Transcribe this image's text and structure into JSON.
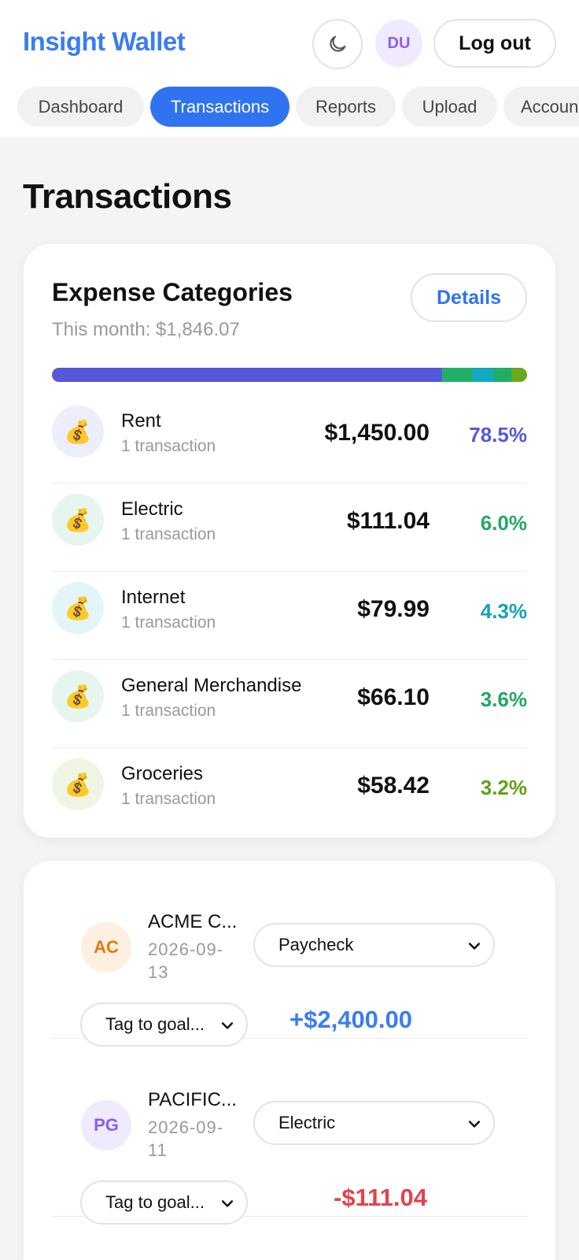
{
  "header": {
    "brand": "Insight Wallet",
    "theme_icon": "moon-icon",
    "user_initials": "DU",
    "logout_label": "Log out",
    "colors": {
      "brand": "#3b7cf0",
      "active_tab": "#2f73f0"
    }
  },
  "tabs": [
    {
      "label": "Dashboard",
      "active": false
    },
    {
      "label": "Transactions",
      "active": true
    },
    {
      "label": "Reports",
      "active": false
    },
    {
      "label": "Upload",
      "active": false
    },
    {
      "label": "Accoun",
      "active": false
    }
  ],
  "page": {
    "title": "Transactions"
  },
  "categories": {
    "title": "Expense Categories",
    "subtitle": "This month: $1,846.07",
    "details_label": "Details",
    "bar_segments": [
      {
        "percent": 78.5,
        "color": "#5558d9"
      },
      {
        "percent": 6.0,
        "color": "#22b067"
      },
      {
        "percent": 4.3,
        "color": "#13a9c2"
      },
      {
        "percent": 3.6,
        "color": "#20ad66"
      },
      {
        "percent": 3.2,
        "color": "#6aa91c"
      }
    ],
    "items": [
      {
        "name": "Rent",
        "count": "1 transaction",
        "amount": "$1,450.00",
        "percent": "78.5%",
        "color": "#5558d9",
        "bg": "#eceefc",
        "icon": "money-bag-icon"
      },
      {
        "name": "Electric",
        "count": "1 transaction",
        "amount": "$111.04",
        "percent": "6.0%",
        "color": "#22a865",
        "bg": "#e6f6ee",
        "icon": "money-bag-icon"
      },
      {
        "name": "Internet",
        "count": "1 transaction",
        "amount": "$79.99",
        "percent": "4.3%",
        "color": "#13a3bb",
        "bg": "#e3f5f8",
        "icon": "money-bag-icon"
      },
      {
        "name": "General Merchandise",
        "count": "1 transaction",
        "amount": "$66.10",
        "percent": "3.6%",
        "color": "#1fa763",
        "bg": "#e6f6ee",
        "icon": "money-bag-icon"
      },
      {
        "name": "Groceries",
        "count": "1 transaction",
        "amount": "$58.42",
        "percent": "3.2%",
        "color": "#62a11a",
        "bg": "#eef6e3",
        "icon": "money-bag-icon"
      }
    ]
  },
  "transactions": [
    {
      "initials": "AC",
      "name": "ACME C...",
      "date": "2026-09-13",
      "category": "Paycheck",
      "goal_placeholder": "Tag to goal...",
      "amount": "+$2,400.00",
      "amount_color": "#3b7cf0",
      "avatar_bg": "#fdf0e1",
      "avatar_fg": "#e07a0c"
    },
    {
      "initials": "PG",
      "name": "PACIFIC...",
      "date": "2026-09-11",
      "category": "Electric",
      "goal_placeholder": "Tag to goal...",
      "amount": "-$111.04",
      "amount_color": "#e2434b",
      "avatar_bg": "#efeafd",
      "avatar_fg": "#8a5cf0"
    }
  ]
}
